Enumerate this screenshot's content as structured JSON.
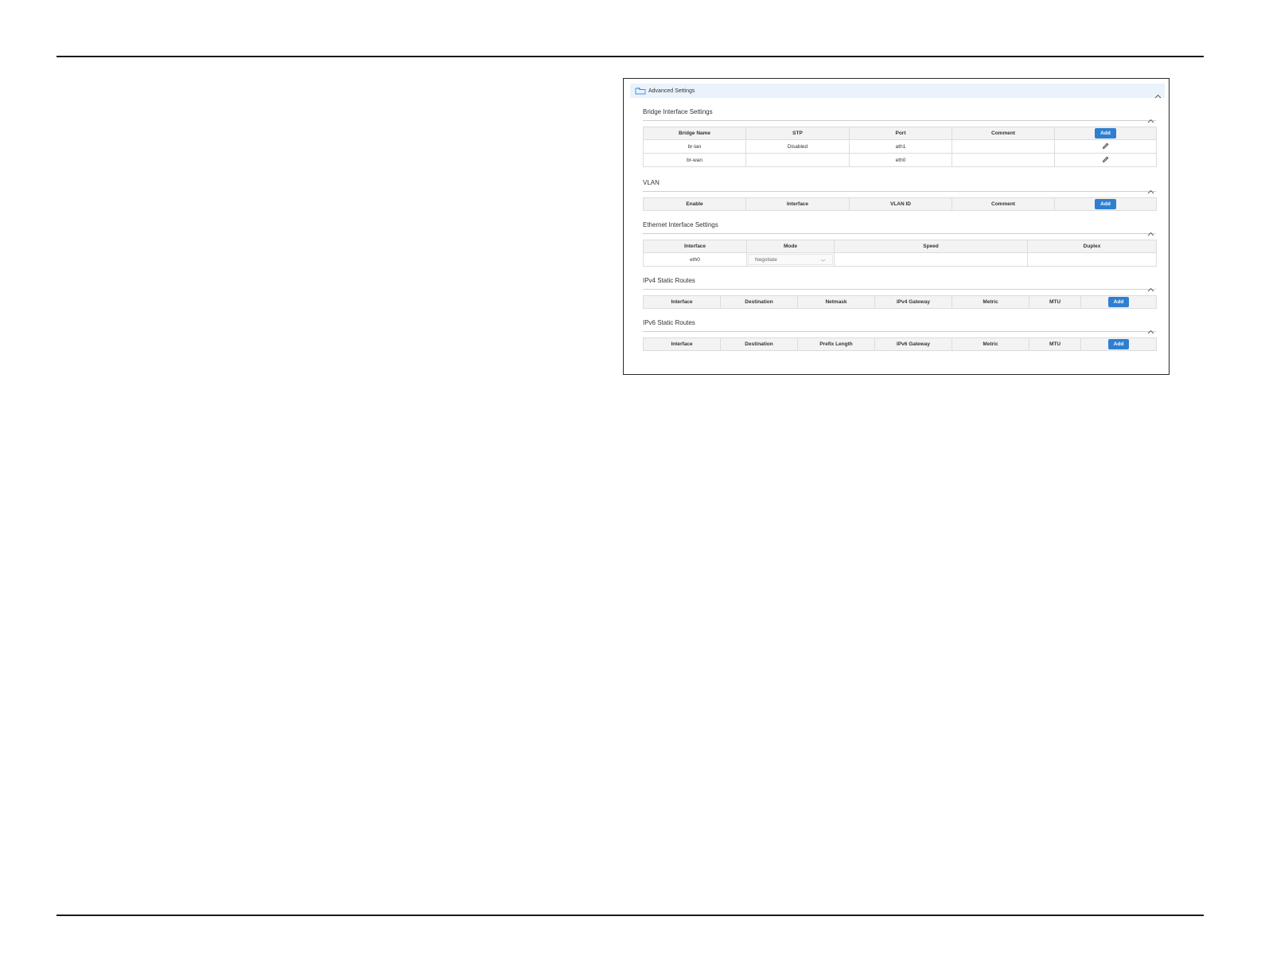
{
  "advanced": {
    "title": "Advanced Settings",
    "icon": "folder-icon"
  },
  "bridge": {
    "title": "Bridge Interface Settings",
    "columns": [
      "Bridge Name",
      "STP",
      "Port",
      "Comment"
    ],
    "add_label": "Add",
    "rows": [
      {
        "name": "br-lan",
        "stp": "Disabled",
        "port": "ath1",
        "comment": ""
      },
      {
        "name": "br-wan",
        "stp": "",
        "port": "eth0",
        "comment": ""
      }
    ]
  },
  "vlan": {
    "title": "VLAN",
    "columns": [
      "Enable",
      "Interface",
      "VLAN ID",
      "Comment"
    ],
    "add_label": "Add"
  },
  "ethernet": {
    "title": "Ethernet Interface Settings",
    "columns": [
      "Interface",
      "Mode",
      "Speed",
      "Duplex"
    ],
    "rows": [
      {
        "interface": "eth0",
        "mode": "Negotiate",
        "speed": "",
        "duplex": ""
      }
    ]
  },
  "ipv4": {
    "title": "IPv4 Static Routes",
    "columns": [
      "Interface",
      "Destination",
      "Netmask",
      "IPv4 Gateway",
      "Metric",
      "MTU"
    ],
    "add_label": "Add"
  },
  "ipv6": {
    "title": "IPv6 Static Routes",
    "columns": [
      "Interface",
      "Destination",
      "Prefix Length",
      "IPv6 Gateway",
      "Metric",
      "MTU"
    ],
    "add_label": "Add"
  },
  "colors": {
    "accent": "#2f7fd0",
    "header_bg": "#eaf2fb",
    "table_header_bg": "#f3f3f3"
  }
}
